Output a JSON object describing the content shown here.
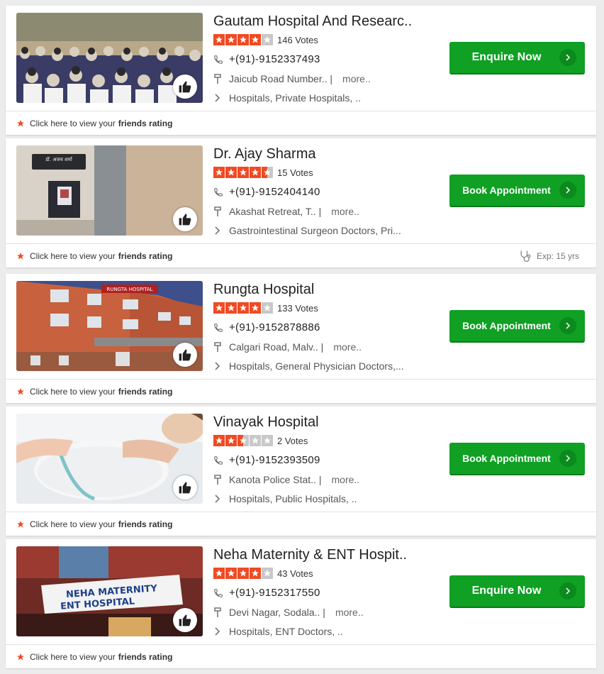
{
  "listings": [
    {
      "title": "Gautam Hospital And Researc..",
      "rating": 4,
      "votes": "146 Votes",
      "phone": "+(91)-9152337493",
      "address": "Jaicub Road Number.. |",
      "more": "more..",
      "categories": "Hospitals, Private Hospitals,  ..",
      "cta": "Enquire Now",
      "footer_text": "Click here to view your",
      "footer_bold": "friends rating"
    },
    {
      "title": "Dr. Ajay Sharma",
      "rating": 4.5,
      "votes": "15 Votes",
      "phone": "+(91)-9152404140",
      "address": "Akashat Retreat, T.. |",
      "more": "more..",
      "categories": "Gastrointestinal Surgeon Doctors, Pri...",
      "cta": "Book Appointment",
      "footer_text": "Click here to view your",
      "footer_bold": "friends rating",
      "experience": "Exp: 15 yrs",
      "sign_text": "डॉ. अजय शर्मा"
    },
    {
      "title": "Rungta Hospital",
      "rating": 4,
      "votes": "133 Votes",
      "phone": "+(91)-9152878886",
      "address": "Calgari Road, Malv.. |",
      "more": "more..",
      "categories": "Hospitals, General Physician Doctors,...",
      "cta": "Book Appointment",
      "footer_text": "Click here to view your",
      "footer_bold": "friends rating",
      "sign_text": "RUNGTA HOSPITAL"
    },
    {
      "title": "Vinayak Hospital",
      "rating": 2.5,
      "votes": "2 Votes",
      "phone": "+(91)-9152393509",
      "address": "Kanota Police Stat.. |",
      "more": "more..",
      "categories": "Hospitals, Public Hospitals,  ..",
      "cta": "Book Appointment",
      "footer_text": "Click here to view your",
      "footer_bold": "friends rating"
    },
    {
      "title": "Neha Maternity & ENT Hospit..",
      "rating": 4,
      "votes": "43 Votes",
      "phone": "+(91)-9152317550",
      "address": "Devi Nagar, Sodala.. |",
      "more": "more..",
      "categories": "Hospitals, ENT Doctors,  ..",
      "cta": "Enquire Now",
      "footer_text": "Click here to view your",
      "footer_bold": "friends rating",
      "sign_line1": "NEHA MATERNITY",
      "sign_line2": "ENT HOSPITAL"
    }
  ],
  "colors": {
    "star_on": "#f04a23",
    "star_off": "#c8c8c8",
    "cta_green": "#0fa024"
  },
  "icons": [
    "phone-icon",
    "map-pin-icon",
    "chevron-right-icon",
    "star-icon",
    "thumbs-up-icon",
    "stethoscope-icon"
  ]
}
